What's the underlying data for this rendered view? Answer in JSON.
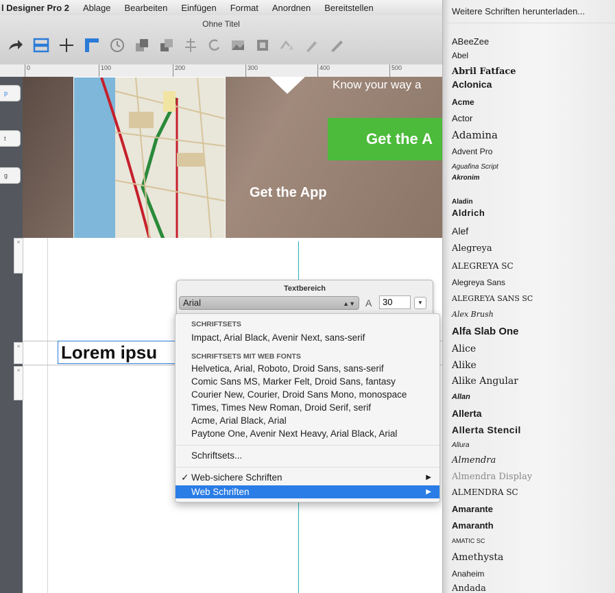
{
  "menubar": {
    "app_name": "l Designer Pro 2",
    "items": [
      "Ablage",
      "Bearbeiten",
      "Einfügen",
      "Format",
      "Anordnen",
      "Bereitstellen"
    ]
  },
  "window": {
    "title": "Ohne Titel"
  },
  "ruler": {
    "marks": [
      "0",
      "100",
      "200",
      "300",
      "400",
      "500"
    ]
  },
  "left_widgets": [
    "p",
    "t",
    "g"
  ],
  "hero": {
    "tagline": "Know your way a",
    "button_label": "Get the A",
    "cta": "Get the App",
    "accent": "#4cba3a"
  },
  "canvas_text": {
    "lorem": "Lorem ipsu"
  },
  "text_panel": {
    "title": "Textbereich",
    "font": "Arial",
    "size": "30"
  },
  "font_menu": {
    "section_sets": "SCHRIFTSETS",
    "sets": [
      "Impact, Arial Black, Avenir Next, sans-serif"
    ],
    "section_web": "SCHRIFTSETS MIT WEB FONTS",
    "web_sets": [
      "Helvetica, Arial, Roboto, Droid Sans, sans-serif",
      "Comic Sans MS, Marker Felt, Droid Sans, fantasy",
      "Courier New, Courier, Droid Sans Mono, monospace",
      "Times, Times New Roman, Droid Serif, serif",
      "Acme, Arial Black, Arial",
      "Paytone One, Avenir Next Heavy, Arial Black, Arial"
    ],
    "manage_sets": "Schriftsets...",
    "websafe": "Web-sichere Schriften",
    "webfonts": "Web Schriften",
    "highlight": "#2a7de6"
  },
  "web_fonts_panel": {
    "more": "Weitere Schriften herunterladen...",
    "fonts": [
      "ABeeZee",
      "Abel",
      "Abril Fatface",
      "Aclonica",
      "Acme",
      "Actor",
      "Adamina",
      "Advent Pro",
      "Aguafina Script",
      "Akronim",
      "Aladin",
      "Aldrich",
      "Alef",
      "Alegreya",
      "ALEGREYA SC",
      "Alegreya Sans",
      "ALEGREYA SANS SC",
      "Alex Brush",
      "Alfa Slab One",
      "Alice",
      "Alike",
      "Alike Angular",
      "Allan",
      "Allerta",
      "Allerta Stencil",
      "Allura",
      "Almendra",
      "Almendra Display",
      "ALMENDRA SC",
      "Amarante",
      "Amaranth",
      "AMATIC SC",
      "Amethysta",
      "Anaheim",
      "Andada"
    ]
  }
}
